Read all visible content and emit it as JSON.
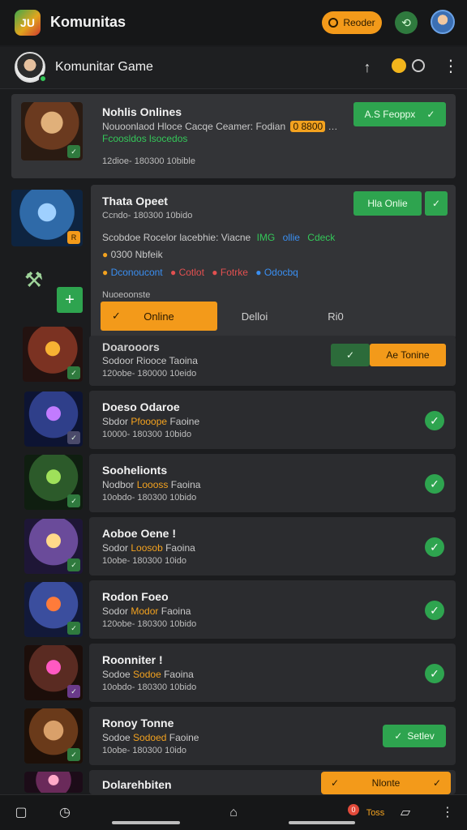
{
  "topbar": {
    "title": "Komunitas",
    "reorder_label": "Reoder",
    "logo_text": "JU"
  },
  "subheader": {
    "title": "Komunitar Game"
  },
  "featured": {
    "title": "Nohlis Onlines",
    "line": "Nouoonlaod Hloce Cacqe Ceamer: Fodian",
    "badge": "0 8800",
    "sub": "Fcoosldos lsocedos",
    "meta": "12dioe- 180300 10bible",
    "action_label": "A.S Feoppx"
  },
  "expanded": {
    "title": "Thata Opeet",
    "meta": "Ccndo- 180300 10bido",
    "desc_line1": "Scobdoe Rocelor lacebhie: Viacne",
    "desc_tail1": "IMG",
    "desc_tail2": "ollie",
    "desc_tail3": "Cdeck",
    "desc_line2": "0300 Nbfeik",
    "tags": [
      "Dconoucont",
      "Cotlot",
      "Fotrke",
      "Odocbq"
    ],
    "section_label": "Nuoeoonste",
    "online_btn": "Hla Onlie",
    "tabs": [
      "Online",
      "Delloi",
      "Ri0"
    ]
  },
  "rows": [
    {
      "title": "Doarooors",
      "sub_pre": "Sodoor",
      "sub_hl": "Riooce",
      "sub_post": "Taoina",
      "meta": "120obe- 180000 10eido",
      "pill_orange": "Ae Tonine"
    },
    {
      "title": "Doeso Odaroe",
      "sub_pre": "Sbdor",
      "sub_hl": "Pfooope",
      "sub_post": "Faoine",
      "meta": "10000- 180300 10bido"
    },
    {
      "title": "Soohelionts",
      "sub_pre": "Nodbor",
      "sub_hl": "Loooss",
      "sub_post": "Faoina",
      "meta": "10obdo- 180300 10bido"
    },
    {
      "title": "Aoboe Oene !",
      "sub_pre": "Sodor",
      "sub_hl": "Loosob",
      "sub_post": "Faoina",
      "meta": "10obe- 180300 10ido"
    },
    {
      "title": "Rodon Foeo",
      "sub_pre": "Sodor",
      "sub_hl": "Modor",
      "sub_post": "Faoina",
      "meta": "120obe- 180300 10bido"
    },
    {
      "title": "Roonniter !",
      "sub_pre": "Sodoe",
      "sub_hl": "Sodoe",
      "sub_post": "Faoina",
      "meta": "10obdo- 180300 10bido"
    },
    {
      "title": "Ronoy Tonne",
      "sub_pre": "Sodoe",
      "sub_hl": "Sodoed",
      "sub_post": "Faoine",
      "meta": "10obe- 180300 10ido",
      "pill_green": "Setlev"
    },
    {
      "title": "Dolarehbiten",
      "pill_orange": "Nlonte"
    }
  ],
  "bottombar": {
    "notif_count": "0",
    "notif_label": "Toss"
  }
}
